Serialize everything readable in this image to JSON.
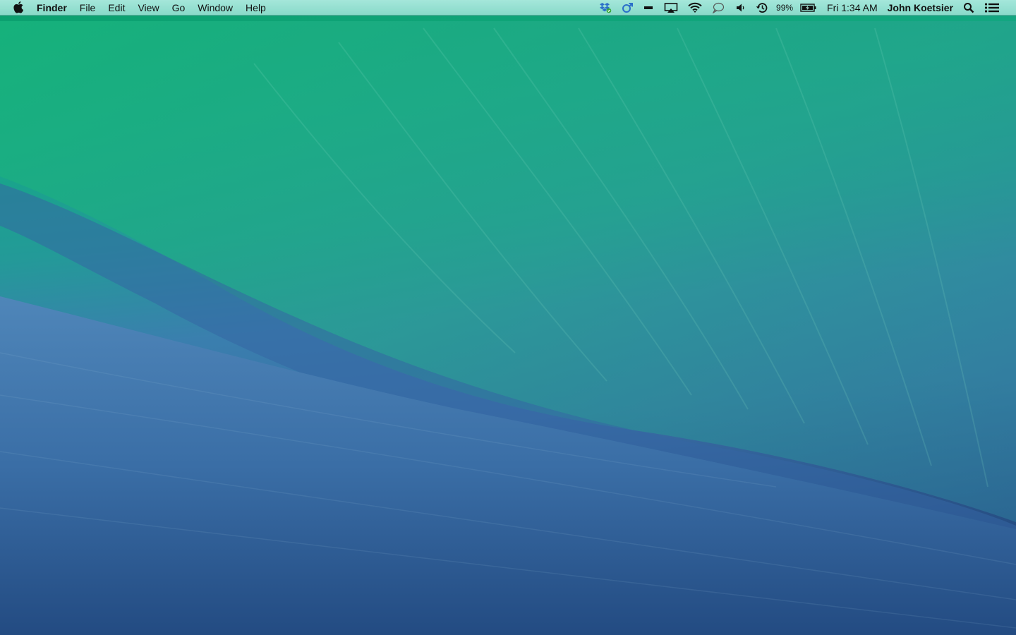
{
  "menubar": {
    "app_name": "Finder",
    "menus": [
      "File",
      "Edit",
      "View",
      "Go",
      "Window",
      "Help"
    ],
    "status_icons": {
      "dropbox": "dropbox-icon",
      "syncing": "sync-icon",
      "mirroring": "display-bar-icon",
      "airplay": "airplay-icon",
      "wifi": "wifi-icon",
      "messages": "messages-bubble-icon",
      "volume": "volume-icon",
      "time_machine": "time-machine-icon",
      "battery": "battery-charging-icon",
      "spotlight": "spotlight-search-icon",
      "notification_center": "notification-center-icon"
    },
    "battery_percent": "99%",
    "clock": "Fri 1:34 AM",
    "user": "John Koetsier"
  },
  "colors": {
    "menubar_bg": "#a8e8dc",
    "wave_top": "#0c9e6f",
    "wave_mid": "#2a85a4",
    "wave_bottom": "#23497f"
  }
}
